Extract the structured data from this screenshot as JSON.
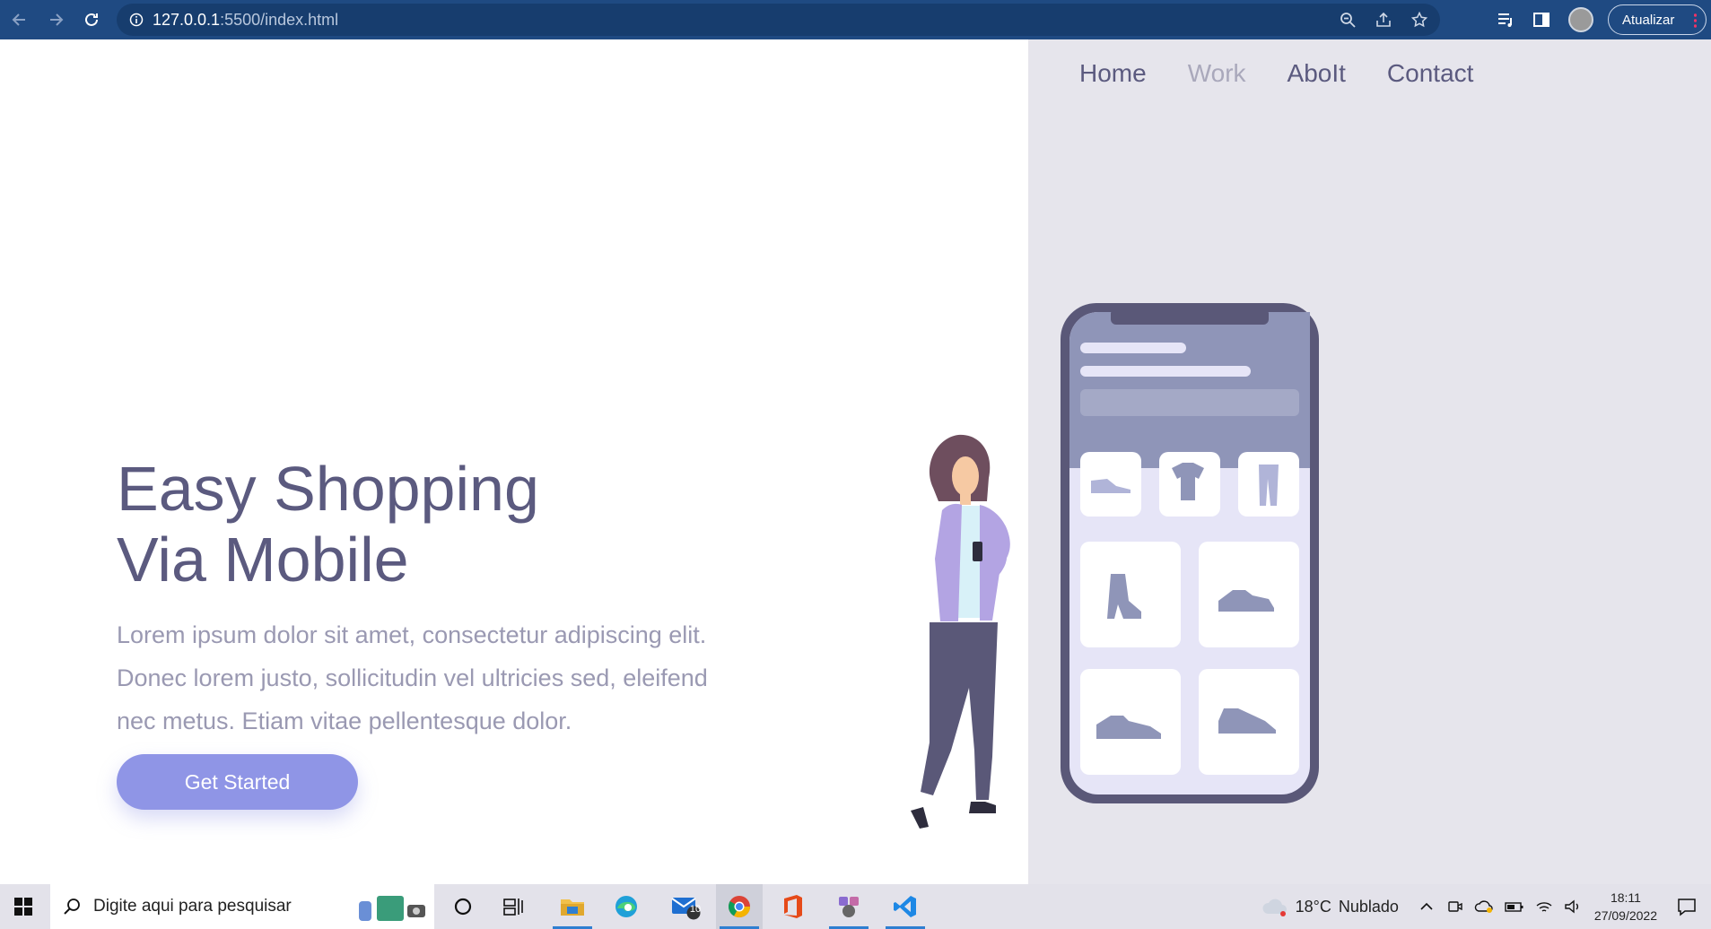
{
  "browser": {
    "url_host": "127.0.0.1",
    "url_path": ":5500/index.html",
    "update_label": "Atualizar"
  },
  "nav": {
    "items": [
      {
        "label": "Home",
        "active": false
      },
      {
        "label": "Work",
        "active": true
      },
      {
        "label": "AboIt",
        "active": false
      },
      {
        "label": "Contact",
        "active": false
      }
    ]
  },
  "hero": {
    "title_line1": "Easy Shopping",
    "title_line2": "Via Mobile",
    "text": "Lorem ipsum dolor sit amet, consectetur adipiscing elit. Donec lorem justo, sollicitudin vel ultricies sed, eleifend nec metus. Etiam vitae pellentesque dolor.",
    "cta_label": "Get Started"
  },
  "taskbar": {
    "search_placeholder": "Digite aqui para pesquisar",
    "mail_badge": "10",
    "weather_temp": "18°C",
    "weather_desc": "Nublado",
    "time": "18:11",
    "date": "27/09/2022"
  },
  "colors": {
    "browser_bar": "#1f4a82",
    "accent": "#8f95e6",
    "heading": "#5b5a7f",
    "body_text": "#9a99b2",
    "panel": "#e6e5ec"
  }
}
